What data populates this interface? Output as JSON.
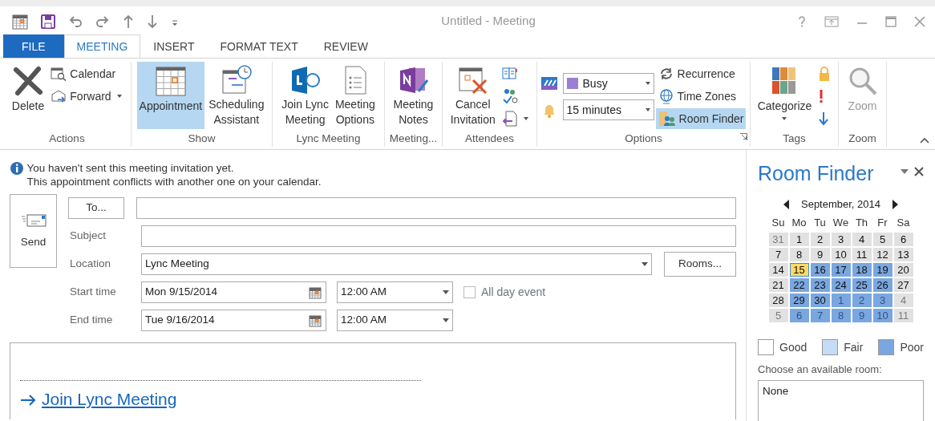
{
  "window": {
    "title": "Untitled - Meeting"
  },
  "tabs": [
    {
      "label": "FILE",
      "kind": "file",
      "selected": false
    },
    {
      "label": "MEETING",
      "kind": "tab",
      "selected": true
    },
    {
      "label": "INSERT",
      "kind": "tab",
      "selected": false
    },
    {
      "label": "FORMAT TEXT",
      "kind": "tab",
      "selected": false
    },
    {
      "label": "REVIEW",
      "kind": "tab",
      "selected": false
    }
  ],
  "ribbon": {
    "groups": [
      {
        "label": "Actions",
        "buttons": [
          {
            "kind": "large",
            "label": "Delete"
          },
          {
            "kind": "small",
            "label": "Calendar"
          },
          {
            "kind": "small",
            "label": "Forward",
            "dropdown": true
          }
        ]
      },
      {
        "label": "Show",
        "buttons": [
          {
            "kind": "large",
            "label": "Appointment",
            "selected": true
          },
          {
            "kind": "large",
            "label": "Scheduling\nAssistant",
            "selected": false
          }
        ]
      },
      {
        "label": "Lync Meeting",
        "buttons": [
          {
            "kind": "large",
            "label": "Join Lync\nMeeting"
          },
          {
            "kind": "large",
            "label": "Meeting\nOptions"
          }
        ]
      },
      {
        "label": "Meeting...",
        "buttons": [
          {
            "kind": "large",
            "label": "Meeting\nNotes"
          }
        ]
      },
      {
        "label": "Attendees",
        "buttons": [
          {
            "kind": "large",
            "label": "Cancel\nInvitation"
          },
          {
            "kind": "icon"
          },
          {
            "kind": "icon"
          },
          {
            "kind": "icon",
            "dropdown": true
          }
        ]
      },
      {
        "label": "Options",
        "launcher": true,
        "buttons": [
          {
            "kind": "combo",
            "value": "Busy"
          },
          {
            "kind": "combo",
            "value": "15 minutes"
          },
          {
            "kind": "small",
            "label": "Recurrence",
            "selected": false
          },
          {
            "kind": "small",
            "label": "Time Zones",
            "selected": false
          },
          {
            "kind": "small",
            "label": "Room Finder",
            "selected": true
          }
        ]
      },
      {
        "label": "Tags",
        "buttons": [
          {
            "kind": "large",
            "label": "Categorize",
            "dropdown": true
          },
          {
            "kind": "icon"
          },
          {
            "kind": "icon"
          },
          {
            "kind": "icon"
          }
        ]
      },
      {
        "label": "Zoom",
        "buttons": [
          {
            "kind": "large",
            "label": "Zoom",
            "disabled": true
          }
        ]
      }
    ]
  },
  "info_bar": {
    "lines": [
      "You haven't sent this meeting invitation yet.",
      "This appointment conflicts with another one on your calendar."
    ]
  },
  "form": {
    "send": "Send",
    "to_button": "To...",
    "subject_label": "Subject",
    "location_label": "Location",
    "location": "Lync Meeting",
    "rooms_button": "Rooms...",
    "start_label": "Start time",
    "start_date": "Mon 9/15/2014",
    "start_time": "12:00 AM",
    "all_day": {
      "label": "All day event",
      "checked": false
    },
    "end_label": "End time",
    "end_date": "Tue 9/16/2014",
    "end_time": "12:00 AM"
  },
  "body": {
    "link": "Join Lync Meeting"
  },
  "room_finder": {
    "title": "Room Finder",
    "month": "September, 2014",
    "weekdays": [
      "Su",
      "Mo",
      "Tu",
      "We",
      "Th",
      "Fr",
      "Sa"
    ],
    "days": [
      {
        "d": "31",
        "kind": "free",
        "outside": true
      },
      {
        "d": "1",
        "kind": "free",
        "outside": false
      },
      {
        "d": "2",
        "kind": "free",
        "outside": false
      },
      {
        "d": "3",
        "kind": "free",
        "outside": false
      },
      {
        "d": "4",
        "kind": "free",
        "outside": false
      },
      {
        "d": "5",
        "kind": "free",
        "outside": false
      },
      {
        "d": "6",
        "kind": "free",
        "outside": false
      },
      {
        "d": "7",
        "kind": "free",
        "outside": false
      },
      {
        "d": "8",
        "kind": "free",
        "outside": false
      },
      {
        "d": "9",
        "kind": "free",
        "outside": false
      },
      {
        "d": "10",
        "kind": "free",
        "outside": false
      },
      {
        "d": "11",
        "kind": "free",
        "outside": false
      },
      {
        "d": "12",
        "kind": "free",
        "outside": false
      },
      {
        "d": "13",
        "kind": "free",
        "outside": false
      },
      {
        "d": "14",
        "kind": "free",
        "outside": false
      },
      {
        "d": "15",
        "kind": "today",
        "outside": false
      },
      {
        "d": "16",
        "kind": "poor",
        "outside": false
      },
      {
        "d": "17",
        "kind": "poor",
        "outside": false
      },
      {
        "d": "18",
        "kind": "poor",
        "outside": false
      },
      {
        "d": "19",
        "kind": "poor",
        "outside": false
      },
      {
        "d": "20",
        "kind": "free",
        "outside": false
      },
      {
        "d": "21",
        "kind": "free",
        "outside": false
      },
      {
        "d": "22",
        "kind": "poor",
        "outside": false
      },
      {
        "d": "23",
        "kind": "poor",
        "outside": false
      },
      {
        "d": "24",
        "kind": "poor",
        "outside": false
      },
      {
        "d": "25",
        "kind": "poor",
        "outside": false
      },
      {
        "d": "26",
        "kind": "poor",
        "outside": false
      },
      {
        "d": "27",
        "kind": "free",
        "outside": false
      },
      {
        "d": "28",
        "kind": "free",
        "outside": false
      },
      {
        "d": "29",
        "kind": "poor",
        "outside": false
      },
      {
        "d": "30",
        "kind": "poor",
        "outside": false
      },
      {
        "d": "1",
        "kind": "poor",
        "outside": true
      },
      {
        "d": "2",
        "kind": "poor",
        "outside": true
      },
      {
        "d": "3",
        "kind": "poor",
        "outside": true
      },
      {
        "d": "4",
        "kind": "free",
        "outside": true
      },
      {
        "d": "5",
        "kind": "free",
        "outside": true
      },
      {
        "d": "6",
        "kind": "poor",
        "outside": true
      },
      {
        "d": "7",
        "kind": "poor",
        "outside": true
      },
      {
        "d": "8",
        "kind": "poor",
        "outside": true
      },
      {
        "d": "9",
        "kind": "poor",
        "outside": true
      },
      {
        "d": "10",
        "kind": "poor",
        "outside": true
      },
      {
        "d": "11",
        "kind": "free",
        "outside": true
      }
    ],
    "legend": [
      {
        "label": "Good",
        "color": "#ffffff"
      },
      {
        "label": "Fair",
        "color": "#c5dcf7"
      },
      {
        "label": "Poor",
        "color": "#7aa7e0"
      }
    ],
    "rooms_label": "Choose an available room:",
    "rooms": [
      "None"
    ]
  }
}
